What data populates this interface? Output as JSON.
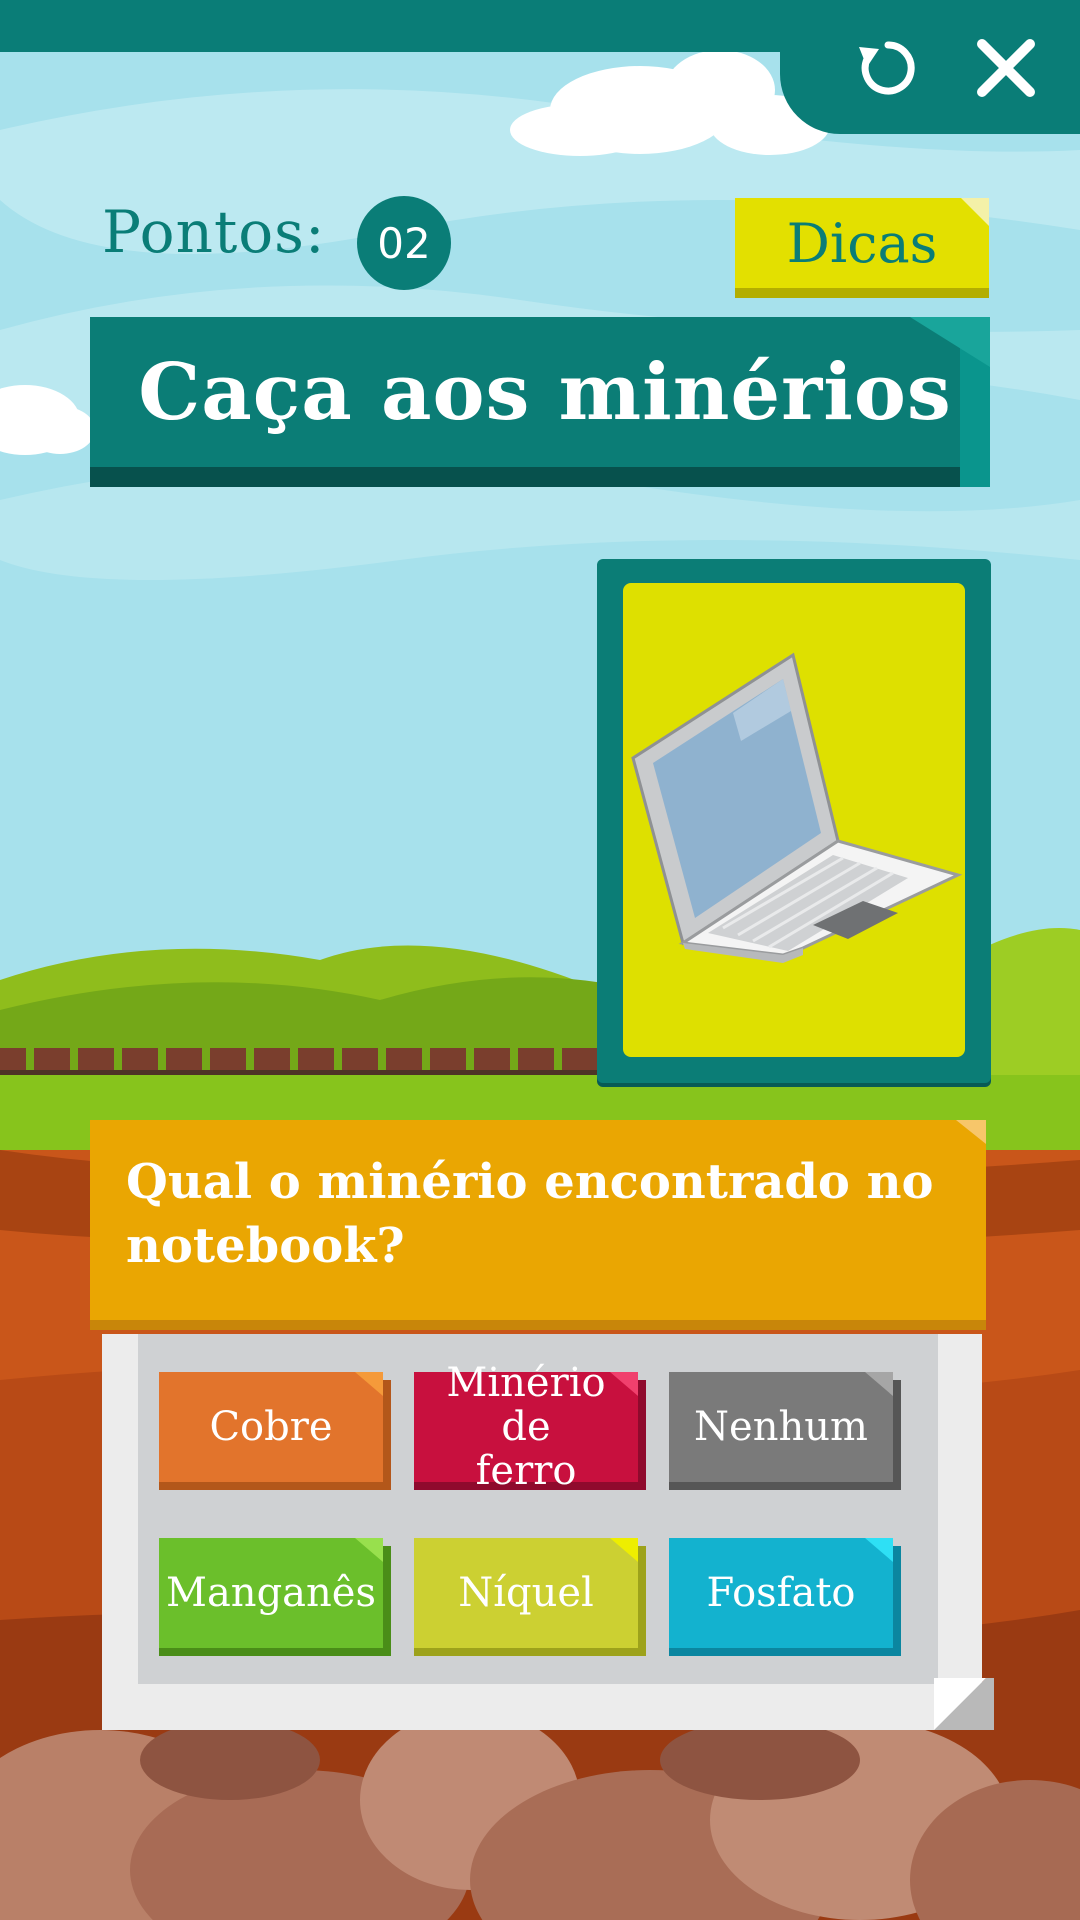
{
  "header": {
    "reload_icon": "reload-icon",
    "close_icon": "close-icon",
    "bar_color": "#0a7d77"
  },
  "score": {
    "label": "Pontos:",
    "value": "02"
  },
  "hints": {
    "label": "Dicas"
  },
  "title": "Caça aos minérios",
  "item_card": {
    "image": "laptop-illustration"
  },
  "question": "Qual o minério encontrado no notebook?",
  "answers": [
    {
      "label": "Cobre",
      "color": "#e2742c",
      "shade": "#b3571a",
      "tip": "#f59a3a"
    },
    {
      "label": "Minério de ferro",
      "color": "#c8103e",
      "shade": "#8f0a2d",
      "tip": "#f0406d"
    },
    {
      "label": "Nenhum",
      "color": "#7a7a7a",
      "shade": "#565656",
      "tip": "#a6a6a6"
    },
    {
      "label": "Manganês",
      "color": "#6bbf2b",
      "shade": "#4a8d18",
      "tip": "#98e04d"
    },
    {
      "label": "Níquel",
      "color": "#ccd032",
      "shade": "#9da21b",
      "tip": "#eeee00"
    },
    {
      "label": "Fosfato",
      "color": "#13b2cf",
      "shade": "#0b86a0",
      "tip": "#2ee0f5"
    }
  ]
}
